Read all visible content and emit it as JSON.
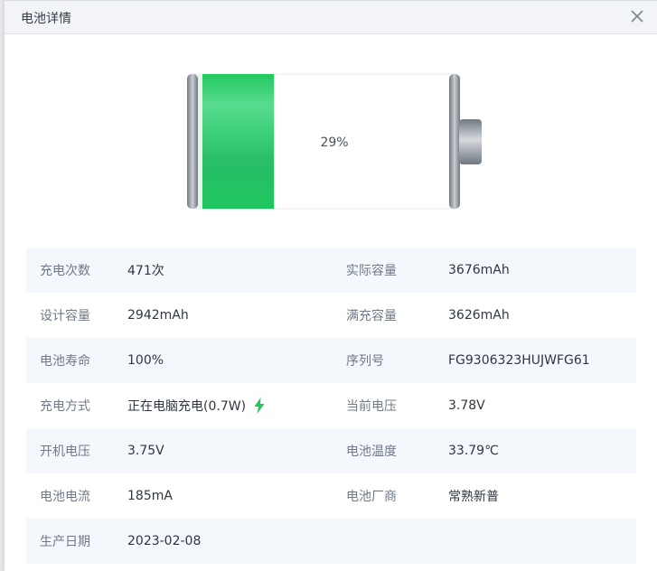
{
  "dialog": {
    "title": "电池详情"
  },
  "battery": {
    "level_percent": 29,
    "label": "29%",
    "colors": {
      "fill": "#22c55e",
      "fill_light": "#4ddb85",
      "frame": "#9aa1a8",
      "terminal": "#9ca3aa"
    }
  },
  "rows": [
    {
      "label1": "充电次数",
      "value1": "471次",
      "label2": "实际容量",
      "value2": "3676mAh"
    },
    {
      "label1": "设计容量",
      "value1": "2942mAh",
      "label2": "满充容量",
      "value2": "3626mAh"
    },
    {
      "label1": "电池寿命",
      "value1": "100%",
      "label2": "序列号",
      "value2": "FG9306323HUJWFG61"
    },
    {
      "label1": "充电方式",
      "value1": "正在电脑充电(0.7W)",
      "label2": "当前电压",
      "value2": "3.78V"
    },
    {
      "label1": "开机电压",
      "value1": "3.75V",
      "label2": "电池温度",
      "value2": "33.79℃"
    },
    {
      "label1": "电池电流",
      "value1": "185mA",
      "label2": "电池厂商",
      "value2": "常熟新普"
    },
    {
      "label1": "生产日期",
      "value1": "2023-02-08",
      "label2": "",
      "value2": ""
    }
  ],
  "icons": {
    "close": "close-icon",
    "charging": "lightning-bolt-icon"
  },
  "colors": {
    "accent_green": "#22c55e",
    "row_shade": "#f4f7fb",
    "label_text": "#707987",
    "value_text": "#2f3641"
  }
}
